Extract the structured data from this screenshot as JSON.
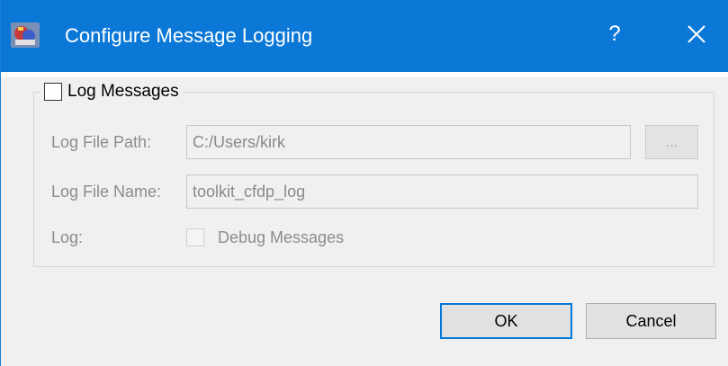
{
  "window": {
    "title": "Configure Message Logging",
    "help_label": "?",
    "title_bar_color": "#0b78d7",
    "icons": {
      "app": "app-icon",
      "close": "close-icon"
    }
  },
  "group": {
    "title": "Log Messages",
    "checked": false
  },
  "fields": {
    "path_label": "Log File Path:",
    "path_value": "C:/Users/kirk",
    "browse_label": "...",
    "name_label": "Log File Name:",
    "name_value": "toolkit_cfdp_log",
    "log_label": "Log:",
    "debug_label": "Debug Messages",
    "debug_checked": false
  },
  "buttons": {
    "ok": "OK",
    "cancel": "Cancel",
    "default_color": "#0078d7"
  }
}
